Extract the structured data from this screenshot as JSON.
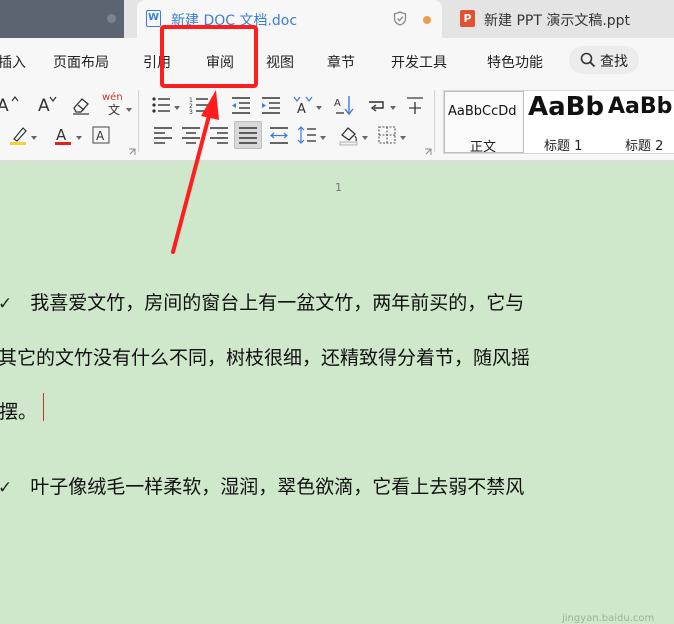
{
  "tabs": {
    "doc_title": "新建 DOC 文档.doc",
    "doc_icon_letter": "W",
    "ppt_title": "新建 PPT 演示文稿.ppt",
    "ppt_icon_letter": "P"
  },
  "menu": {
    "items": [
      "插入",
      "页面布局",
      "引用",
      "审阅",
      "视图",
      "章节",
      "开发工具",
      "特色功能"
    ],
    "search_label": "查找",
    "highlighted": "审阅"
  },
  "toolbar": {
    "phonetic_label": "wén",
    "styles": [
      {
        "sample": "AaBbCcDd",
        "label": "正文"
      },
      {
        "sample": "AaBb",
        "label": "标题 1"
      },
      {
        "sample": "AaBb",
        "label": "标题 2"
      }
    ]
  },
  "document": {
    "page_number": "1",
    "paragraph1": [
      "我喜爱文竹，房间的窗台上有一盆文竹，两年前买的，它与",
      "其它的文竹没有什么不同，树枝很细，还精致得分着节，随风摇",
      "摆。"
    ],
    "paragraph2": [
      "叶子像绒毛一样柔软，湿润，翠色欲滴，它看上去弱不禁风"
    ],
    "bullet_glyph": "✓"
  },
  "watermark": "jingyan.baidu.com",
  "colors": {
    "accent_blue": "#3a7dd8",
    "annotation_red": "#ff1e1e",
    "doc_background": "#cfe8cb",
    "ppt_orange": "#e2502e"
  }
}
